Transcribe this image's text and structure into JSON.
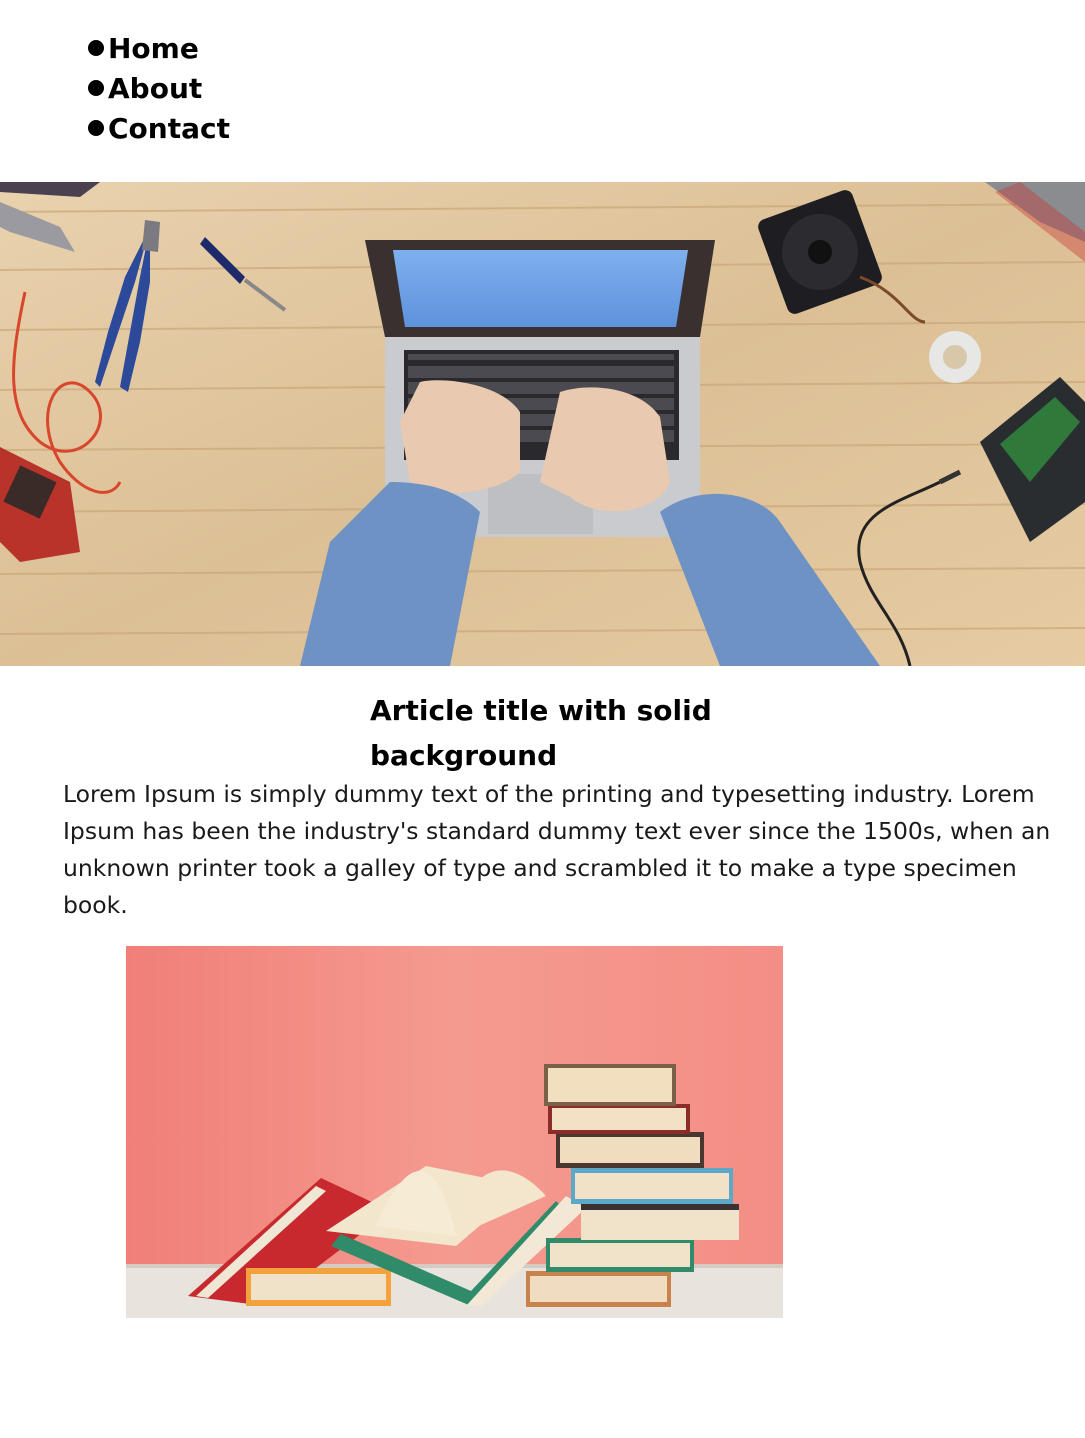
{
  "nav": {
    "items": [
      {
        "label": "Home"
      },
      {
        "label": "About"
      },
      {
        "label": "Contact"
      }
    ]
  },
  "hero_image": {
    "description_icon": "laptop-workbench-photo",
    "colors": {
      "wood": "#e3c9a3",
      "screen": "#6ea3e6",
      "shirt": "#6f92c4"
    }
  },
  "article": {
    "title": "Article title with solid background",
    "body": "Lorem Ipsum is simply dummy text of the printing and typesetting industry. Lorem Ipsum has been the industry's standard dummy text ever since the 1500s, when an unknown printer took a galley of type and scrambled it to make a type specimen book."
  },
  "books_image": {
    "description_icon": "books-stack-photo",
    "colors": {
      "background": "#f4958c",
      "table": "#e8e2dc"
    }
  }
}
